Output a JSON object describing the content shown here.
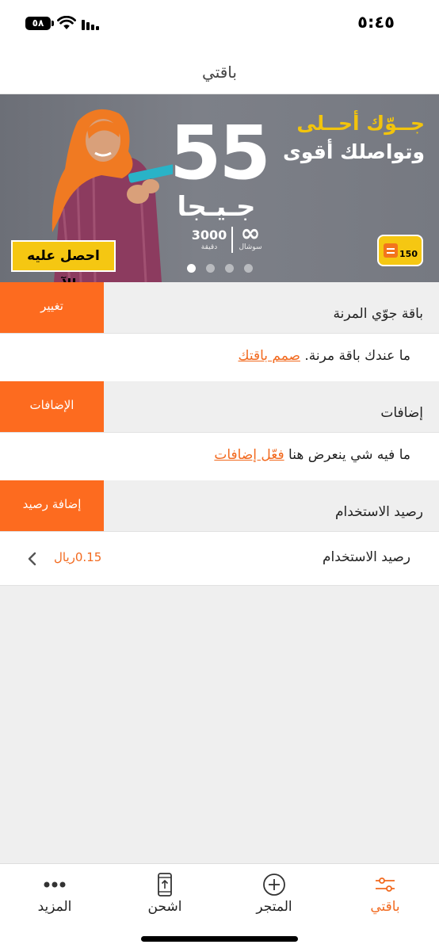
{
  "status_bar": {
    "time": "٥:٤٥",
    "battery": "٥٨"
  },
  "header": {
    "title": "باقتي"
  },
  "banner": {
    "headline_1": "جــوّك أحــلى",
    "headline_2": "وتواصلك أقوى",
    "amount": "55",
    "unit": "جـيـجا",
    "minutes_value": "3000",
    "minutes_label": "دقيقة",
    "social_symbol": "∞",
    "social_label": "سوشال",
    "cta_label": "احصل عليه الآن",
    "sim_label": "150",
    "dots_count": 4,
    "active_dot": 0
  },
  "sections": [
    {
      "title": "باقة جوّي المرنة",
      "button": "تغيير",
      "info_text": "ما عندك باقة مرنة.",
      "info_link": "صمم باقتك"
    },
    {
      "title": "إضافات",
      "button": "الإضافات",
      "info_text": "ما فيه شي ينعرض هنا",
      "info_link": "فعّل إضافات"
    },
    {
      "title": "رصيد الاستخدام",
      "button": "إضافة رصيد",
      "info_text": "رصيد الاستخدام",
      "amount": "0.15ريال"
    }
  ],
  "tab_bar": {
    "items": [
      {
        "label": "باقتي",
        "icon": "sliders-icon",
        "active": true
      },
      {
        "label": "المتجر",
        "icon": "plus-circle-icon",
        "active": false
      },
      {
        "label": "اشحن",
        "icon": "phone-upload-icon",
        "active": false
      },
      {
        "label": "المزيد",
        "icon": "more-dots-icon",
        "active": false
      }
    ]
  },
  "colors": {
    "accent": "#fd6b1f",
    "link": "#f26a1f",
    "banner_yellow": "#f5c712",
    "section_bg": "#efefef"
  }
}
